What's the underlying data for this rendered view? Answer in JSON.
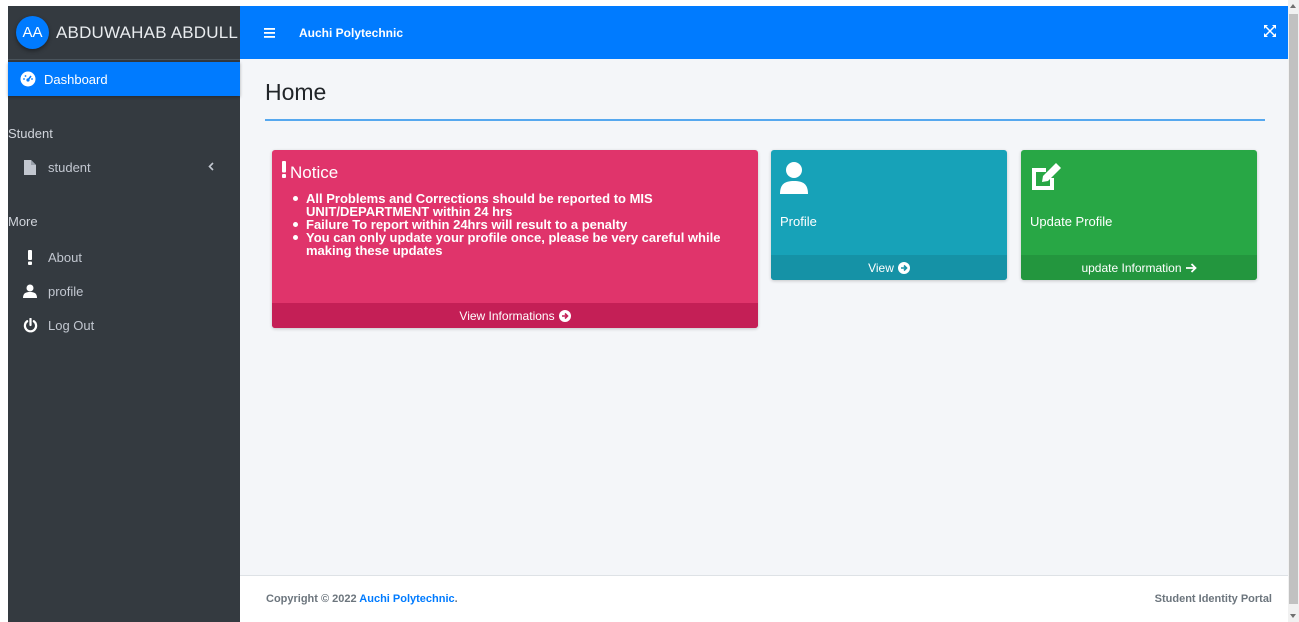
{
  "sidebar": {
    "avatar_initials": "AA",
    "user_name": "ABDUWAHAB ABDULL",
    "dashboard_label": "Dashboard",
    "section_student": "Student",
    "student_label": "student",
    "section_more": "More",
    "about_label": "About",
    "profile_label": "profile",
    "logout_label": "Log Out"
  },
  "topbar": {
    "title": "Auchi Polytechnic"
  },
  "main": {
    "page_title": "Home",
    "notice": {
      "heading": "Notice",
      "items": [
        "All Problems and Corrections should be reported to MIS UNIT/DEPARTMENT within 24 hrs",
        "Failure To report within 24hrs will result to a penalty",
        "You can only update your profile once, please be very careful while making these updates"
      ],
      "footer_label": "View Informations"
    },
    "profile_card": {
      "label": "Profile",
      "footer_label": "View"
    },
    "update_card": {
      "label": "Update Profile",
      "footer_label": "update Information"
    }
  },
  "footer": {
    "copyright_prefix": "Copyright © 2022",
    "copyright_link": "Auchi Polytechnic",
    "copyright_suffix": ".",
    "right_text": "Student Identity Portal"
  },
  "colors": {
    "primary": "#007bff",
    "sidebar_bg": "#343a40",
    "notice_bg": "#e0346b",
    "profile_bg": "#17a2b8",
    "update_bg": "#28a745"
  }
}
